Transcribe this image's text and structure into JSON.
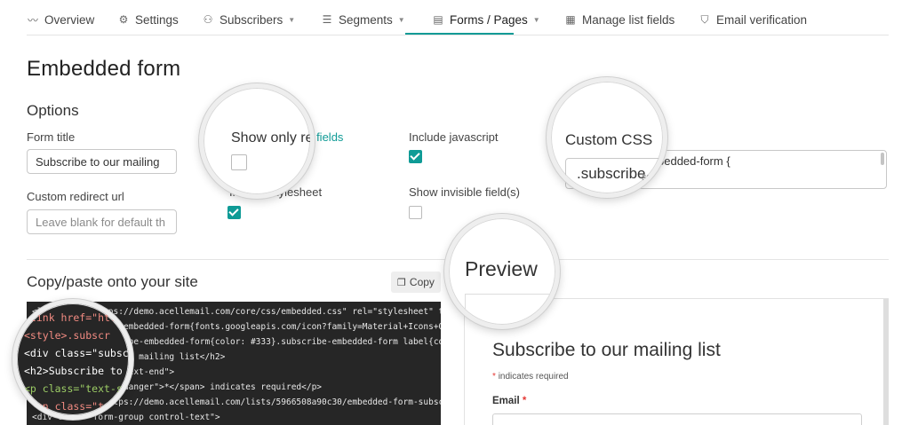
{
  "nav": {
    "items": [
      {
        "label": "Overview",
        "icon": "overview-icon"
      },
      {
        "label": "Settings",
        "icon": "gear-icon"
      },
      {
        "label": "Subscribers",
        "icon": "users-icon"
      },
      {
        "label": "Segments",
        "icon": "segments-icon"
      },
      {
        "label": "Forms / Pages",
        "icon": "form-icon",
        "active": true
      },
      {
        "label": "Manage list fields",
        "icon": "list-fields-icon"
      },
      {
        "label": "Email verification",
        "icon": "shield-icon"
      }
    ],
    "accent_color": "#0f9b96"
  },
  "page": {
    "title": "Embedded form"
  },
  "options": {
    "title": "Options",
    "form_title_label": "Form title",
    "form_title_value": "Subscribe to our mailing",
    "redirect_label": "Custom redirect url",
    "redirect_placeholder": "Leave blank for default th",
    "show_required_label_a": "Show only re",
    "show_required_label_b": "ed fields",
    "include_stylesheet_label": "Include stylesheet",
    "include_javascript_label": "Include javascript",
    "show_invisible_label": "Show invisible field(s)",
    "custom_css_label": "Custom CSS",
    "custom_css_value": "bedded-form {"
  },
  "checkboxes": {
    "show_required": false,
    "include_stylesheet": true,
    "include_javascript": true,
    "show_invisible": false
  },
  "lens": {
    "show_only": "Show only re",
    "custom_css": "Custom CSS",
    "css_snippet": ".subscribe",
    "css_tail": "ss",
    "preview": "Preview",
    "code_lines": [
      "<link href=\"htt",
      "<style>.subscr",
      "<div class=\"subsc",
      "<h2>Subscribe to o",
      "<p class=\"text-sm",
      "span class=\"te"
    ]
  },
  "copy": {
    "title": "Copy/paste onto your site",
    "button_label": "Copy",
    "code_lines": [
      {
        "c": "t",
        "text": "<link href=\"https://demo.acellemail.com/core/css/embedded.css\" rel=\"stylesheet\" type=\""
      },
      {
        "c": "t",
        "text": "<style>.subscribe-embedded-form{fonts.googleapis.com/icon?family=Material+Icons+Outlined\" rel=\"sty"
      },
      {
        "c": "w",
        "text": "<div class=\"subscribe-embedded-form{color: #333}.subscribe-embedded-form label{color: #555"
      },
      {
        "c": "t",
        "text": "<h2>Subscribe to our mailing list</h2>"
      },
      {
        "c": "s",
        "text": "<p class=\"text-sm text-end\">"
      },
      {
        "c": "t",
        "text": "<span class=\"text-danger\">*</span> indicates required</p>"
      },
      {
        "c": "w",
        "text": "<form action=\"https://demo.acellemail.com/lists/5966508a90c30/embedded-form-subscribe-"
      },
      {
        "c": "s",
        "text": "<div class=\"form-group control-text\">"
      }
    ]
  },
  "preview": {
    "title": "Subscribe to our mailing list",
    "required_star": "*",
    "required_text": "indicates required",
    "email_label": "Email",
    "email_star": "*"
  }
}
